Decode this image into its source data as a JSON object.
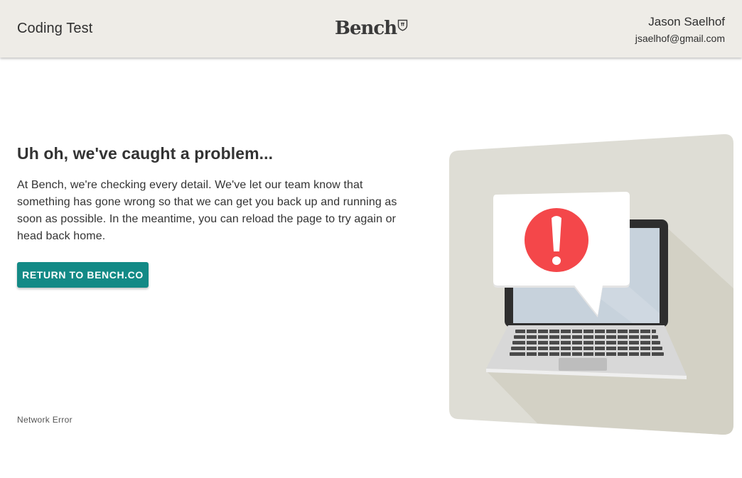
{
  "header": {
    "app_title": "Coding Test",
    "logo_text": "Bench",
    "user": {
      "name": "Jason Saelhof",
      "email": "jsaelhof@gmail.com"
    }
  },
  "error": {
    "title": "Uh oh, we've caught a problem...",
    "body": "At Bench, we're checking every detail. We've let our team know that something has gone wrong so that we can get you back up and running as soon as possible. In the meantime, you can reload the page to try again or head back home.",
    "button_label": "RETURN TO BENCH.CO",
    "code": "Network Error"
  },
  "colors": {
    "header_bg": "#eeece7",
    "button_bg": "#138a86",
    "alert_red": "#f4474a",
    "illustration_bg": "#deddd5"
  },
  "icons": {
    "logo_badge": "shield-icon",
    "illustration": "laptop-error-illustration",
    "alert": "exclamation-icon"
  }
}
